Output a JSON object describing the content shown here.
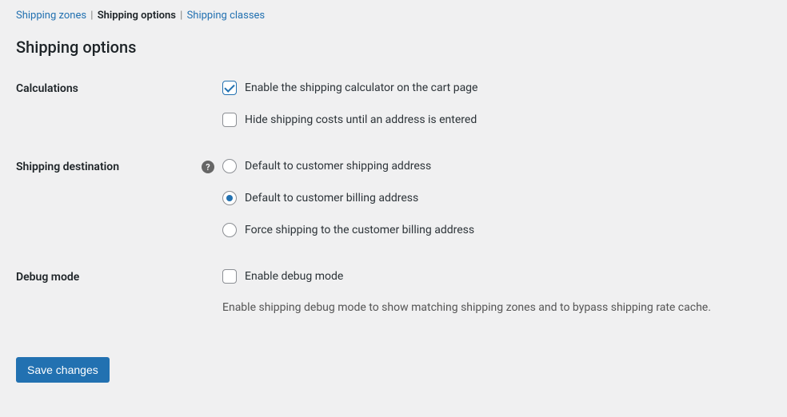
{
  "tabs": {
    "zones": "Shipping zones",
    "options": "Shipping options",
    "classes": "Shipping classes"
  },
  "page_title": "Shipping options",
  "calculations": {
    "label": "Calculations",
    "enable_calc": {
      "label": "Enable the shipping calculator on the cart page",
      "checked": true
    },
    "hide_costs": {
      "label": "Hide shipping costs until an address is entered",
      "checked": false
    }
  },
  "destination": {
    "label": "Shipping destination",
    "options": {
      "ship_addr": {
        "label": "Default to customer shipping address",
        "selected": false
      },
      "bill_addr": {
        "label": "Default to customer billing address",
        "selected": true
      },
      "force_bill": {
        "label": "Force shipping to the customer billing address",
        "selected": false
      }
    }
  },
  "debug": {
    "label": "Debug mode",
    "enable": {
      "label": "Enable debug mode",
      "checked": false
    },
    "description": "Enable shipping debug mode to show matching shipping zones and to bypass shipping rate cache."
  },
  "save_label": "Save changes"
}
